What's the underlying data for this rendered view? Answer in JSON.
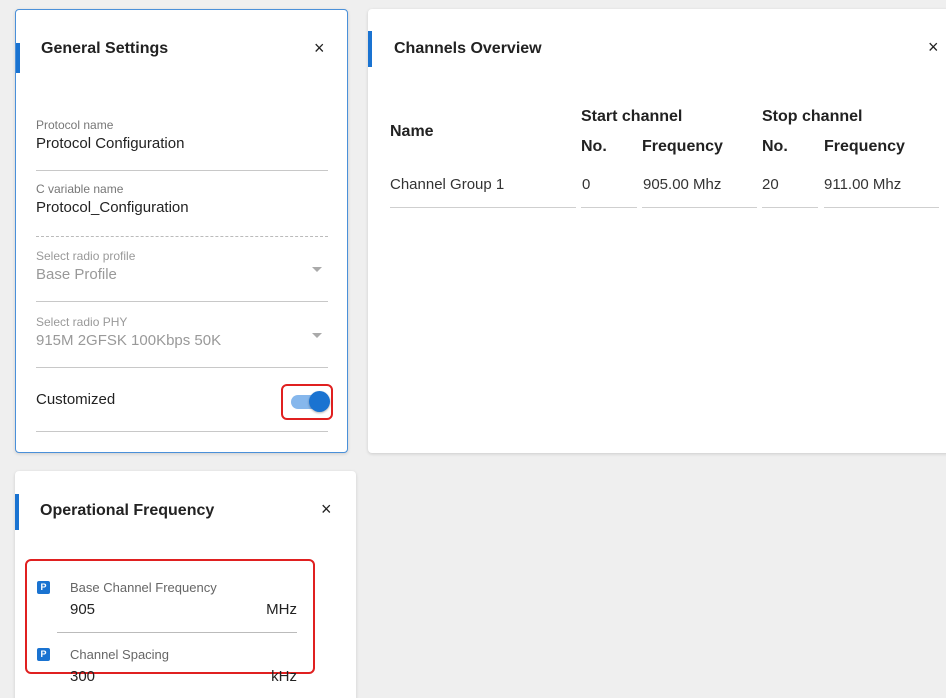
{
  "general": {
    "title": "General Settings",
    "close": "×",
    "protocol_name": {
      "label": "Protocol name",
      "value": "Protocol Configuration"
    },
    "c_variable": {
      "label": "C variable name",
      "value": "Protocol_Configuration"
    },
    "radio_profile": {
      "label": "Select radio profile",
      "value": "Base Profile"
    },
    "radio_phy": {
      "label": "Select radio PHY",
      "value": "915M 2GFSK 100Kbps 50K"
    },
    "customized": {
      "label": "Customized",
      "state": "on"
    }
  },
  "channels": {
    "title": "Channels Overview",
    "close": "×",
    "headers": {
      "name": "Name",
      "start_group": "Start channel",
      "stop_group": "Stop channel",
      "start_no": "No.",
      "start_freq": "Frequency",
      "stop_no": "No.",
      "stop_freq": "Frequency"
    },
    "rows": [
      {
        "name": "Channel Group 1",
        "start_no": "0",
        "start_freq": "905.00 Mhz",
        "stop_no": "20",
        "stop_freq": "911.00 Mhz"
      }
    ]
  },
  "opfreq": {
    "title": "Operational Frequency",
    "close": "×",
    "badge": "P",
    "base": {
      "label": "Base Channel Frequency",
      "value": "905",
      "unit": "MHz"
    },
    "spacing": {
      "label": "Channel Spacing",
      "value": "300",
      "unit": "kHz"
    }
  },
  "colors": {
    "accent": "#1a73d1",
    "highlight": "#e02020"
  }
}
